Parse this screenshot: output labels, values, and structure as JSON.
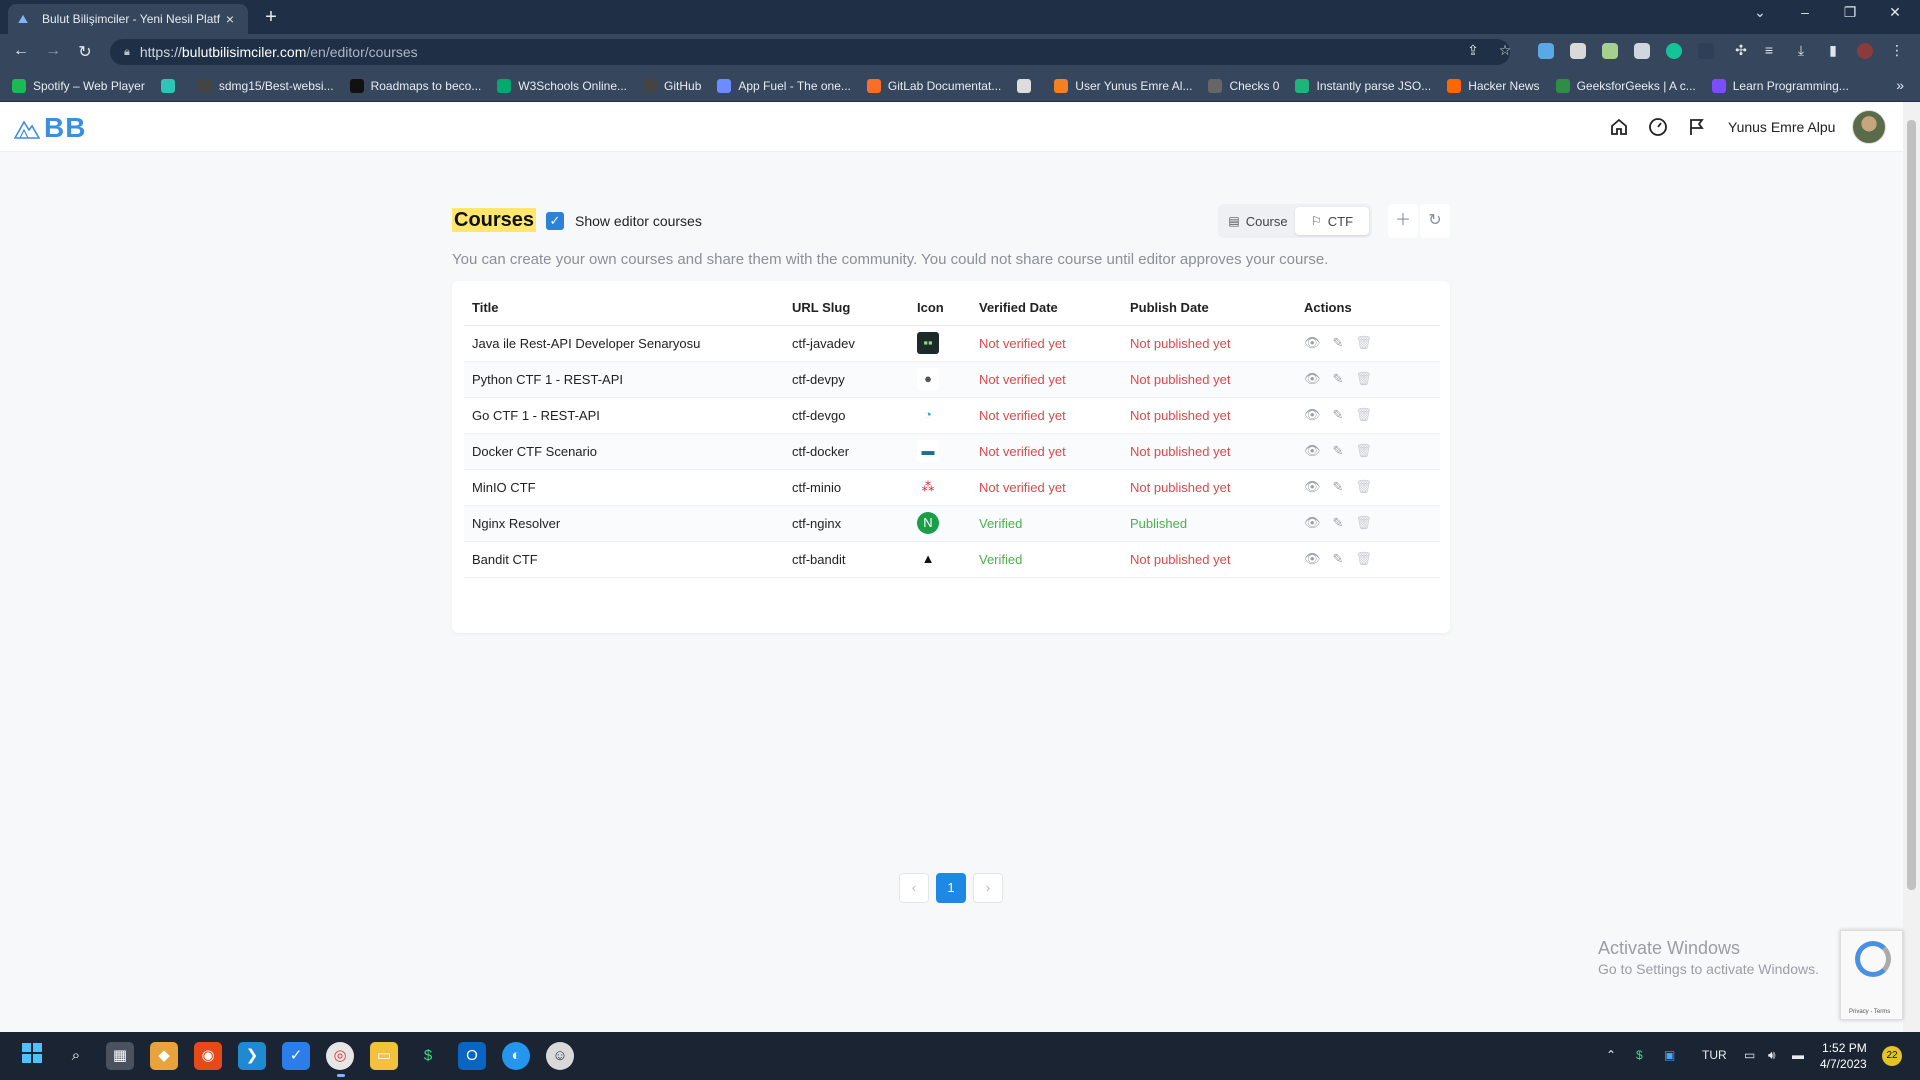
{
  "browser": {
    "tab_title": "Bulut Bilişimciler - Yeni Nesil Platf",
    "url_scheme": "https://",
    "url_host": "bulutbilisimciler.com",
    "url_path": "/en/editor/courses",
    "bookmarks": [
      {
        "label": "Spotify – Web Player",
        "icon": "spotify-icon",
        "color": "#1db954"
      },
      {
        "label": "",
        "icon": "bookmark-icon",
        "color": "#2ec4b6"
      },
      {
        "label": "sdmg15/Best-websi...",
        "icon": "github-icon",
        "color": "#444444"
      },
      {
        "label": "Roadmaps to beco...",
        "icon": "roadmap-icon",
        "color": "#111111"
      },
      {
        "label": "W3Schools Online...",
        "icon": "w3schools-icon",
        "color": "#04aa6d"
      },
      {
        "label": "GitHub",
        "icon": "github-icon",
        "color": "#444444"
      },
      {
        "label": "App Fuel - The one...",
        "icon": "appfuel-icon",
        "color": "#6c8cff"
      },
      {
        "label": "GitLab Documentat...",
        "icon": "gitlab-icon",
        "color": "#fc6d26"
      },
      {
        "label": "",
        "icon": "globe-icon",
        "color": "#dddddd"
      },
      {
        "label": "User Yunus Emre Al...",
        "icon": "stackoverflow-icon",
        "color": "#f48024"
      },
      {
        "label": "Checks 0",
        "icon": "checks-icon",
        "color": "#666666"
      },
      {
        "label": "Instantly parse JSO...",
        "icon": "quicktype-icon",
        "color": "#1fb57a"
      },
      {
        "label": "Hacker News",
        "icon": "hackernews-icon",
        "color": "#ff6600"
      },
      {
        "label": "GeeksforGeeks | A c...",
        "icon": "geeksforgeeks-icon",
        "color": "#2f8d46"
      },
      {
        "label": "Learn Programming...",
        "icon": "learn-icon",
        "color": "#7b4dff"
      }
    ]
  },
  "header": {
    "logo_text": "BB",
    "username": "Yunus Emre Alpu"
  },
  "page": {
    "title": "Courses",
    "show_editor_label": "Show editor courses",
    "show_editor_checked": true,
    "segment": {
      "course_label": "Course",
      "ctf_label": "CTF",
      "active": "CTF"
    },
    "description": "You can create your own courses and share them with the community. You could not share course until editor approves your course."
  },
  "table": {
    "headers": {
      "title": "Title",
      "slug": "URL Slug",
      "icon": "Icon",
      "verified": "Verified Date",
      "publish": "Publish Date",
      "actions": "Actions"
    },
    "rows": [
      {
        "title": "Java ile Rest-API Developer Senaryosu",
        "slug": "ctf-javadev",
        "icon": "terminal-icon",
        "icon_bg": "#1e2a2a",
        "verified": "Not verified yet",
        "publish": "Not published yet",
        "verified_ok": false,
        "published_ok": false
      },
      {
        "title": "Python CTF 1 - REST-API",
        "slug": "ctf-devpy",
        "icon": "python-icon",
        "icon_bg": "#ffffff",
        "verified": "Not verified yet",
        "publish": "Not published yet",
        "verified_ok": false,
        "published_ok": false
      },
      {
        "title": "Go CTF 1 - REST-API",
        "slug": "ctf-devgo",
        "icon": "gopher-icon",
        "icon_bg": "#ffffff",
        "verified": "Not verified yet",
        "publish": "Not published yet",
        "verified_ok": false,
        "published_ok": false
      },
      {
        "title": "Docker CTF Scenario",
        "slug": "ctf-docker",
        "icon": "docker-icon",
        "icon_bg": "#ffffff",
        "verified": "Not verified yet",
        "publish": "Not published yet",
        "verified_ok": false,
        "published_ok": false
      },
      {
        "title": "MinIO CTF",
        "slug": "ctf-minio",
        "icon": "minio-icon",
        "icon_bg": "#ffffff",
        "verified": "Not verified yet",
        "publish": "Not published yet",
        "verified_ok": false,
        "published_ok": false
      },
      {
        "title": "Nginx Resolver",
        "slug": "ctf-nginx",
        "icon": "nginx-icon",
        "icon_bg": "#ffffff",
        "verified": "Verified",
        "publish": "Published",
        "verified_ok": true,
        "published_ok": true
      },
      {
        "title": "Bandit CTF",
        "slug": "ctf-bandit",
        "icon": "linux-icon",
        "icon_bg": "#ffffff",
        "verified": "Verified",
        "publish": "Not published yet",
        "verified_ok": true,
        "published_ok": false
      }
    ]
  },
  "pagination": {
    "prev": "‹",
    "current": "1",
    "next": "›"
  },
  "watermark": {
    "line1": "Activate Windows",
    "line2": "Go to Settings to activate Windows."
  },
  "recaptcha": {
    "text": "Privacy - Terms"
  },
  "taskbar": {
    "language": "TUR",
    "time": "1:52 PM",
    "date": "4/7/2023",
    "notifications": "22"
  },
  "colors": {
    "accent": "#1e88e5",
    "error": "#e0474c",
    "success": "#4caf50",
    "highlight": "#ffe66d"
  }
}
